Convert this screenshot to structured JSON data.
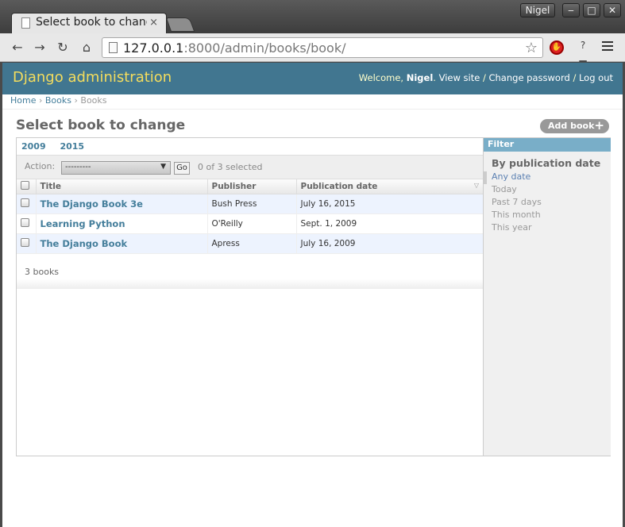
{
  "browser": {
    "tab_title": "Select book to change",
    "tab_close": "×",
    "user": "Nigel",
    "url_host": "127.0.0.1",
    "url_rest": ":8000/admin/books/book/",
    "window_min": "‒",
    "window_max": "□",
    "window_close": "✕"
  },
  "header": {
    "branding": "Django administration",
    "welcome": "Welcome,",
    "username": "Nigel",
    "view_site": "View site",
    "change_password": "Change password",
    "log_out": "Log out",
    "sep": "/"
  },
  "breadcrumbs": {
    "home": "Home",
    "books_app": "Books",
    "current": "Books",
    "sep": "›"
  },
  "page": {
    "title": "Select book to change",
    "add_button": "Add book"
  },
  "date_hierarchy": [
    "2009",
    "2015"
  ],
  "actions": {
    "label": "Action:",
    "selected": "---------",
    "go": "Go",
    "counter": "0 of 3 selected"
  },
  "table": {
    "columns": [
      "Title",
      "Publisher",
      "Publication date"
    ],
    "rows": [
      {
        "title": "The Django Book 3e",
        "publisher": "Bush Press",
        "date": "July 16, 2015"
      },
      {
        "title": "Learning Python",
        "publisher": "O'Reilly",
        "date": "Sept. 1, 2009"
      },
      {
        "title": "The Django Book",
        "publisher": "Apress",
        "date": "July 16, 2009"
      }
    ]
  },
  "paginator": "3 books",
  "filter": {
    "heading": "Filter",
    "section": "By publication date",
    "options": [
      "Any date",
      "Today",
      "Past 7 days",
      "This month",
      "This year"
    ]
  }
}
